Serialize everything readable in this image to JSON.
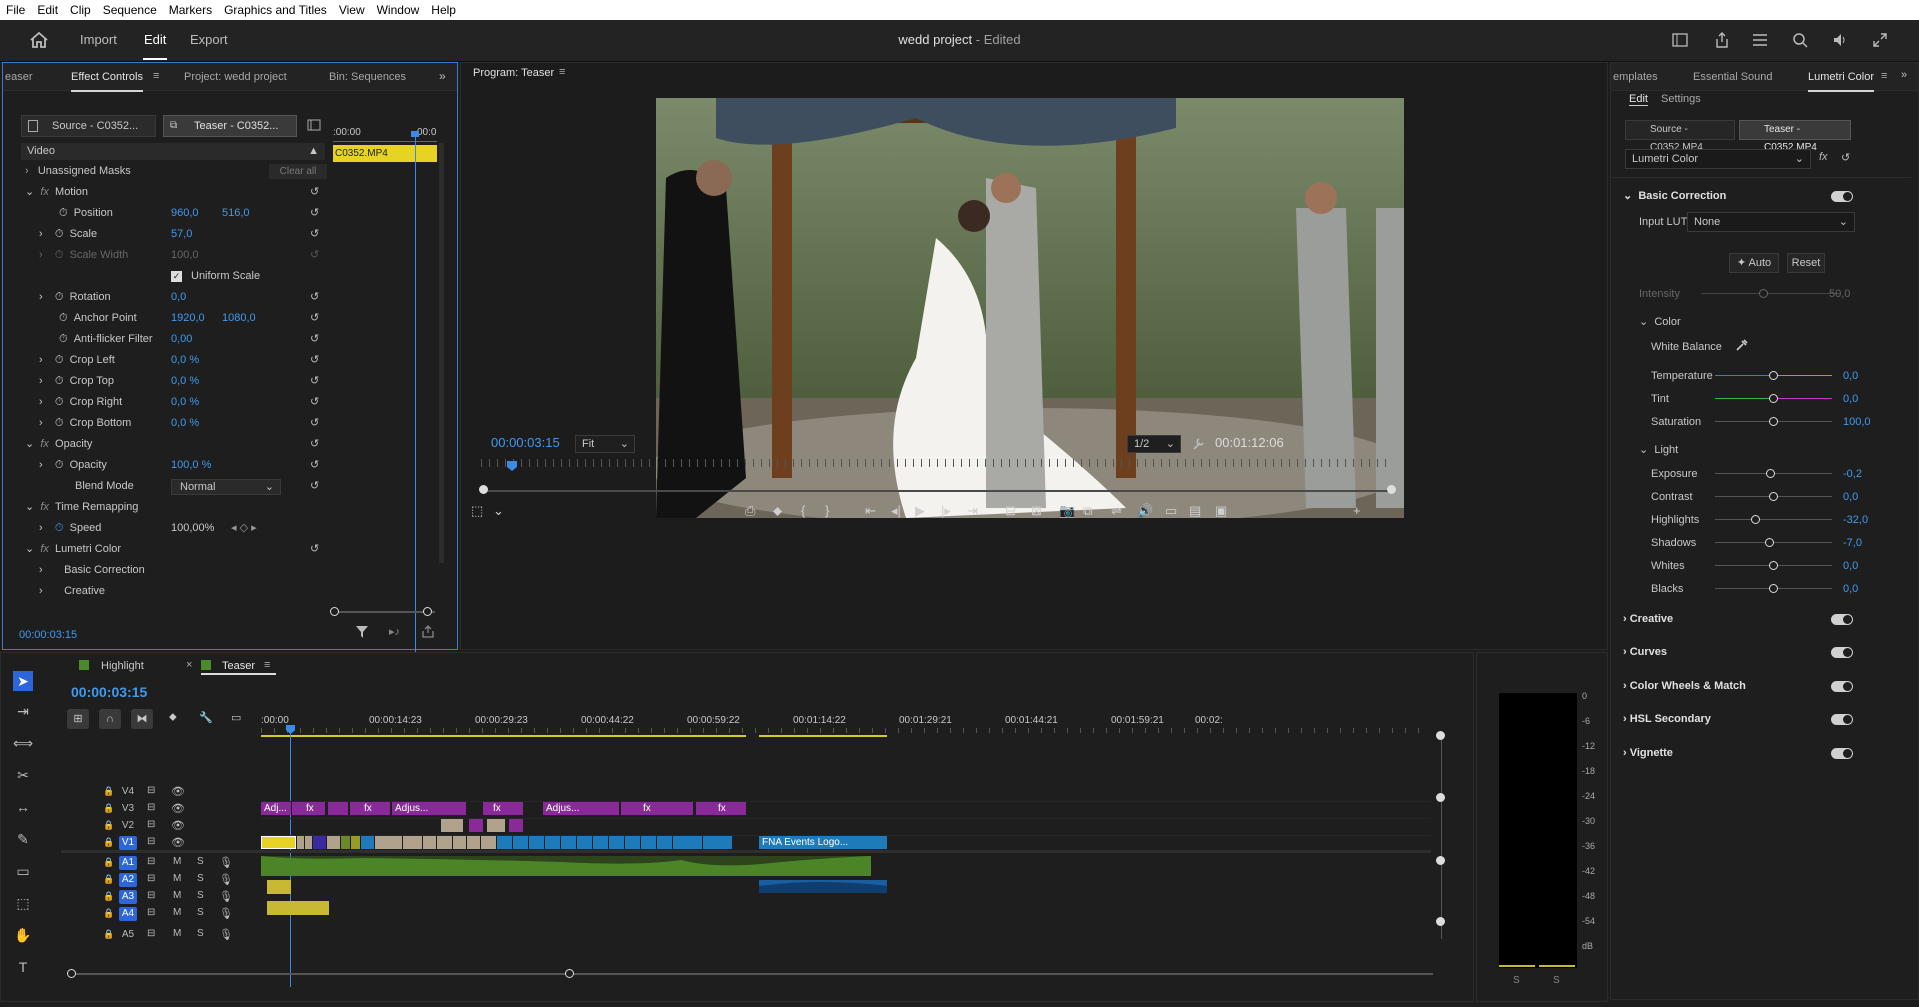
{
  "menu": [
    "File",
    "Edit",
    "Clip",
    "Sequence",
    "Markers",
    "Graphics and Titles",
    "View",
    "Window",
    "Help"
  ],
  "header": {
    "nav": [
      "Import",
      "Edit",
      "Export"
    ],
    "active": "Edit",
    "project_title": "wedd project",
    "project_status": "- Edited"
  },
  "effect_controls": {
    "tabs": [
      "easer",
      "Effect Controls",
      "Project: wedd project",
      "Bin: Sequences"
    ],
    "source_tab": "Source - C0352...",
    "teaser_tab": "Teaser - C0352...",
    "ruler_start": ":00:00",
    "ruler_end": "00:0",
    "clip_name": "C0352.MP4",
    "video_label": "Video",
    "unassigned_masks": "Unassigned Masks",
    "clear_all": "Clear all",
    "motion": "Motion",
    "position_label": "Position",
    "position_x": "960,0",
    "position_y": "516,0",
    "scale_label": "Scale",
    "scale_val": "57,0",
    "scale_width_label": "Scale Width",
    "scale_width_val": "100,0",
    "uniform_scale": "Uniform Scale",
    "rotation_label": "Rotation",
    "rotation_val": "0,0",
    "anchor_label": "Anchor Point",
    "anchor_x": "1920,0",
    "anchor_y": "1080,0",
    "antiflicker_label": "Anti-flicker Filter",
    "antiflicker_val": "0,00",
    "crop_left_label": "Crop Left",
    "crop_left_val": "0,0 %",
    "crop_top_label": "Crop Top",
    "crop_top_val": "0,0 %",
    "crop_right_label": "Crop Right",
    "crop_right_val": "0,0 %",
    "crop_bottom_label": "Crop Bottom",
    "crop_bottom_val": "0,0 %",
    "opacity_group": "Opacity",
    "opacity_label": "Opacity",
    "opacity_val": "100,0 %",
    "blend_label": "Blend Mode",
    "blend_val": "Normal",
    "time_remap": "Time Remapping",
    "speed_label": "Speed",
    "speed_val": "100,00%",
    "lumetri": "Lumetri Color",
    "basic_correction": "Basic Correction",
    "creative": "Creative",
    "timecode": "00:00:03:15"
  },
  "program": {
    "title": "Program: Teaser",
    "timecode": "00:00:03:15",
    "fit": "Fit",
    "resolution": "1/2",
    "duration": "00:01:12:06"
  },
  "lumetri": {
    "tabs": [
      "emplates",
      "Essential Sound",
      "Lumetri Color"
    ],
    "subtabs": [
      "Edit",
      "Settings"
    ],
    "source_tab": "Source - C0352.MP4",
    "teaser_tab": "Teaser - C0352.MP4",
    "effect_select": "Lumetri Color",
    "basic_correction": "Basic Correction",
    "input_lut_label": "Input LUT",
    "input_lut_val": "None",
    "auto": "Auto",
    "reset": "Reset",
    "intensity_label": "Intensity",
    "intensity_val": "50,0",
    "color_label": "Color",
    "white_balance": "White Balance",
    "temperature_label": "Temperature",
    "temperature_val": "0,0",
    "tint_label": "Tint",
    "tint_val": "0,0",
    "saturation_label": "Saturation",
    "saturation_val": "100,0",
    "light_label": "Light",
    "exposure_label": "Exposure",
    "exposure_val": "-0,2",
    "contrast_label": "Contrast",
    "contrast_val": "0,0",
    "highlights_label": "Highlights",
    "highlights_val": "-32,0",
    "shadows_label": "Shadows",
    "shadows_val": "-7,0",
    "whites_label": "Whites",
    "whites_val": "0,0",
    "blacks_label": "Blacks",
    "blacks_val": "0,0",
    "sections": [
      "Creative",
      "Curves",
      "Color Wheels & Match",
      "HSL Secondary",
      "Vignette"
    ]
  },
  "timeline": {
    "tab_highlight": "Highlight",
    "tab_teaser": "Teaser",
    "timecode": "00:00:03:15",
    "ruler": [
      ":00:00",
      "00:00:14:23",
      "00:00:29:23",
      "00:00:44:22",
      "00:00:59:22",
      "00:01:14:22",
      "00:01:29:21",
      "00:01:44:21",
      "00:01:59:21",
      "00:02:"
    ],
    "tracks_video": [
      "V4",
      "V3",
      "V2",
      "V1"
    ],
    "tracks_audio": [
      "A1",
      "A2",
      "A3",
      "A4"
    ],
    "master": "A5",
    "clip_adj1": "Adj...",
    "clip_adj2": "Adjus...",
    "clip_adj3": "Adjus...",
    "clip_fna": "FNA Events Logo...",
    "fx": "fx"
  },
  "meter": {
    "scale": [
      "0",
      "-6",
      "-12",
      "-18",
      "-24",
      "-30",
      "-36",
      "-42",
      "-48",
      "-54",
      "dB"
    ],
    "solo": [
      "S",
      "S"
    ]
  }
}
